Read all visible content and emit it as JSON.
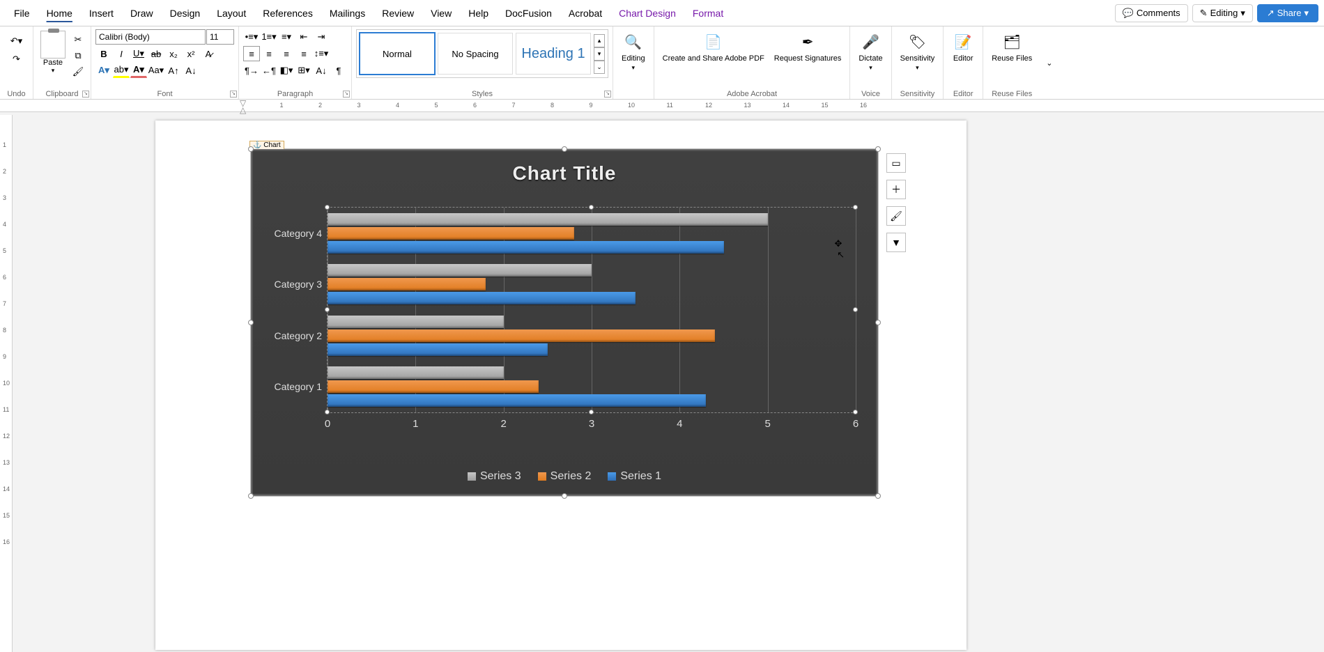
{
  "menu": {
    "tabs": [
      "File",
      "Home",
      "Insert",
      "Draw",
      "Design",
      "Layout",
      "References",
      "Mailings",
      "Review",
      "View",
      "Help",
      "DocFusion",
      "Acrobat",
      "Chart Design",
      "Format"
    ],
    "active": "Home",
    "contextual_start": 13,
    "comments": "Comments",
    "editing": "Editing",
    "share": "Share"
  },
  "ribbon": {
    "undo_group": "Undo",
    "clipboard_group": "Clipboard",
    "paste": "Paste",
    "font_group": "Font",
    "font_name": "Calibri (Body)",
    "font_size": "11",
    "paragraph_group": "Paragraph",
    "styles_group": "Styles",
    "style_normal": "Normal",
    "style_nospacing": "No Spacing",
    "style_heading1": "Heading 1",
    "editing_group": "Editing",
    "editing_label": "Editing",
    "acrobat_group": "Adobe Acrobat",
    "acrobat_create": "Create and Share Adobe PDF",
    "acrobat_request": "Request Signatures",
    "voice_group": "Voice",
    "dictate": "Dictate",
    "sensitivity_group": "Sensitivity",
    "sensitivity": "Sensitivity",
    "editor_group": "Editor",
    "editor": "Editor",
    "reuse_group": "Reuse Files",
    "reuse": "Reuse Files"
  },
  "chart_anchor": "Chart",
  "chart_float": {
    "layout": "layout-options-icon",
    "elements": "plus-icon",
    "styles": "brush-icon",
    "filter": "funnel-icon"
  },
  "chart_data": {
    "type": "bar",
    "orientation": "horizontal",
    "title": "Chart Title",
    "xlabel": "",
    "ylabel": "",
    "xlim": [
      0,
      6
    ],
    "xticks": [
      0,
      1,
      2,
      3,
      4,
      5,
      6
    ],
    "categories": [
      "Category 1",
      "Category 2",
      "Category 3",
      "Category 4"
    ],
    "series": [
      {
        "name": "Series 1",
        "color": "#3b82d4",
        "values": [
          4.3,
          2.5,
          3.5,
          4.5
        ]
      },
      {
        "name": "Series 2",
        "color": "#ed7d31",
        "values": [
          2.4,
          4.4,
          1.8,
          2.8
        ]
      },
      {
        "name": "Series 3",
        "color": "#a5a5a5",
        "values": [
          2.0,
          2.0,
          3.0,
          5.0
        ]
      }
    ],
    "legend_order": [
      "Series 3",
      "Series 2",
      "Series 1"
    ]
  }
}
